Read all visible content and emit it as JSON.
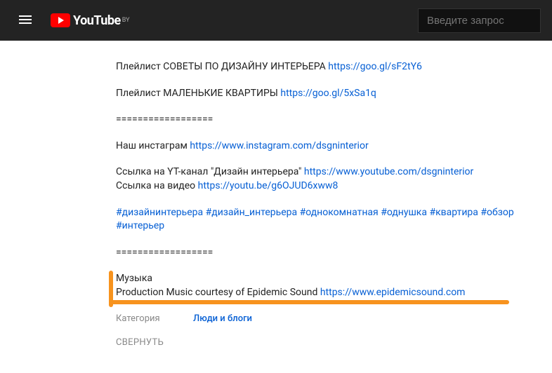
{
  "header": {
    "logo_text": "YouTube",
    "logo_region": "BY",
    "search_placeholder": "Введите запрос"
  },
  "description": {
    "partial_top": "",
    "playlist1": {
      "text": "Плейлист СОВЕТЫ ПО ДИЗАЙНУ ИНТЕРЬЕРА ",
      "link": "https://goo.gl/sF2tY6"
    },
    "playlist2": {
      "text": "Плейлист МАЛЕНЬКИЕ КВАРТИРЫ ",
      "link": "https://goo.gl/5xSa1q"
    },
    "divider1": "==================",
    "instagram": {
      "text": "Наш инстаграм ",
      "link": "https://www.instagram.com/dsgninterior"
    },
    "channel": {
      "text": "Ссылка на YT-канал \"Дизайн интерьера\" ",
      "link": "https://www.youtube.com/dsgninterior"
    },
    "video": {
      "text": "Ссылка на видео ",
      "link": "https://youtu.be/g6OJUD6xww8"
    },
    "hashtags": [
      "#дизайнинтерьера",
      "#дизайн_интерьера",
      "#однокомнатная",
      "#однушка",
      "#квартира",
      "#обзор",
      "#интерьер"
    ],
    "divider2": "==================",
    "music_title": "Музыка",
    "music_text": "Production Music courtesy of Epidemic Sound ",
    "music_link": "https://www.epidemicsound.com",
    "category_label": "Категория",
    "category_value": "Люди и блоги",
    "collapse": "СВЕРНУТЬ"
  }
}
